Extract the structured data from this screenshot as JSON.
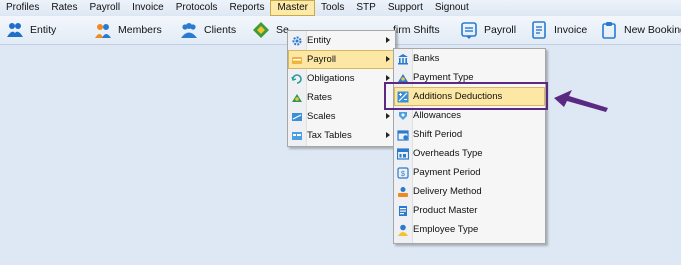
{
  "menubar": {
    "items": [
      "Profiles",
      "Rates",
      "Payroll",
      "Invoice",
      "Protocols",
      "Reports",
      "Master",
      "Tools",
      "STP",
      "Support",
      "Signout"
    ],
    "active_index": 6
  },
  "toolbar": {
    "entity": "Entity",
    "members": "Members",
    "clients": "Clients",
    "se_partial": "Se",
    "confirm_shifts_partial": "firm Shifts",
    "payroll": "Payroll",
    "invoice": "Invoice",
    "new_booking": "New Booking"
  },
  "master_menu": {
    "items": [
      "Entity",
      "Payroll",
      "Obligations",
      "Rates",
      "Scales",
      "Tax Tables"
    ],
    "highlighted": "Payroll"
  },
  "payroll_submenu": {
    "items": [
      "Banks",
      "Payment Type",
      "Additions  Deductions",
      "Allowances",
      "Shift Period",
      "Overheads Type",
      "Payment Period",
      "Delivery Method",
      "Product Master",
      "Employee Type"
    ],
    "highlighted": "Additions  Deductions"
  },
  "colors": {
    "highlight_fill": "#fde7a4",
    "annotation": "#5a2a82",
    "background": "#dde8f4"
  },
  "annotation": {
    "icon": "arrow-left-icon"
  }
}
